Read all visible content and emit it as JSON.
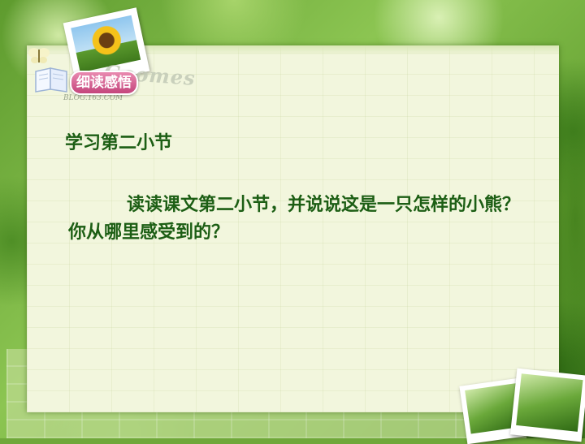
{
  "badge": {
    "label": "细读感悟"
  },
  "decor": {
    "word": "Goomes",
    "sub": "BLOG.163.COM"
  },
  "content": {
    "heading": "学习第二小节",
    "paragraph": "读读课文第二小节，并说说这是一只怎样的小熊？你从哪里感受到的？"
  },
  "colors": {
    "text": "#1c5e14",
    "badge": "#c4457c",
    "paper": "#f2f6dd",
    "frame": "#6fa83a"
  }
}
